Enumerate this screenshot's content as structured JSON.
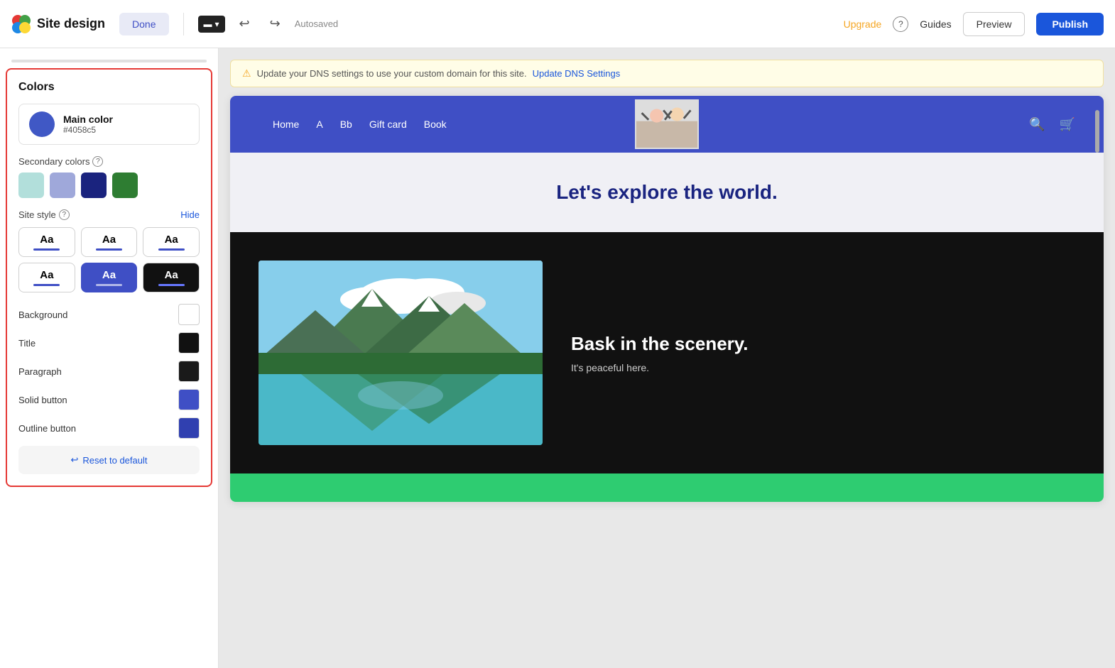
{
  "toolbar": {
    "title": "Site design",
    "done_label": "Done",
    "device_icon": "▬",
    "autosaved_text": "Autosaved",
    "upgrade_label": "Upgrade",
    "help_label": "?",
    "guides_label": "Guides",
    "preview_label": "Preview",
    "publish_label": "Publish"
  },
  "left_panel": {
    "colors_title": "Colors",
    "main_color_name": "Main color",
    "main_color_hex": "#4058c5",
    "main_color_value": "#4058c5",
    "secondary_colors_label": "Secondary colors",
    "secondary_colors": [
      {
        "id": "sec1",
        "color": "#b2dfdb"
      },
      {
        "id": "sec2",
        "color": "#9fa8da"
      },
      {
        "id": "sec3",
        "color": "#1a237e"
      },
      {
        "id": "sec4",
        "color": "#2e7d32"
      }
    ],
    "site_style_label": "Site style",
    "hide_label": "Hide",
    "style_options": [
      {
        "id": "s1",
        "label": "Aa",
        "type": "default"
      },
      {
        "id": "s2",
        "label": "Aa",
        "type": "default"
      },
      {
        "id": "s3",
        "label": "Aa",
        "type": "default"
      },
      {
        "id": "s4",
        "label": "Aa",
        "type": "default"
      },
      {
        "id": "s5",
        "label": "Aa",
        "type": "blue-selected"
      },
      {
        "id": "s6",
        "label": "Aa",
        "type": "dark"
      }
    ],
    "background_label": "Background",
    "title_label": "Title",
    "paragraph_label": "Paragraph",
    "solid_button_label": "Solid button",
    "outline_button_label": "Outline button",
    "reset_label": "Reset to default"
  },
  "dns_banner": {
    "text": "Update your DNS settings to use your custom domain for this site.",
    "link_text": "Update DNS Settings"
  },
  "site_preview": {
    "nav_items": [
      "Home",
      "A",
      "Bb",
      "Gift card",
      "Book"
    ],
    "hero_text": "Let's explore the world.",
    "section_title": "Bask in the scenery.",
    "section_subtitle": "It's peaceful here."
  }
}
